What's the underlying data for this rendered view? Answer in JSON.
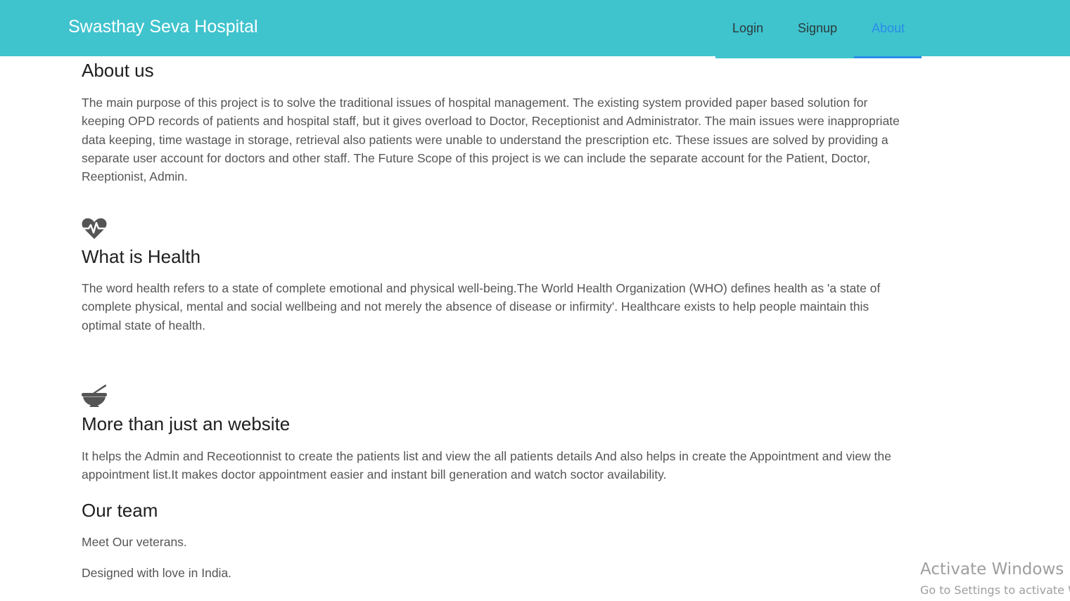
{
  "navbar": {
    "brand": "Swasthay Seva Hospital",
    "links": {
      "login": "Login",
      "signup": "Signup",
      "about": "About"
    },
    "active_link": "about",
    "background_color": "#3fc3cd",
    "active_color": "#2a8de8"
  },
  "sections": {
    "about": {
      "heading": "About us",
      "body": "The main purpose of this project is to solve the traditional issues of hospital management. The existing system provided paper based solution for keeping OPD records of patients and hospital staff, but it gives overload to Doctor, Receptionist and Administrator. The main issues were inappropriate data keeping, time wastage in storage, retrieval also patients were unable to understand the prescription etc. These issues are solved by providing a separate user account for doctors and other staff. The Future Scope of this project is we can include the separate account for the Patient, Doctor, Reeptionist, Admin."
    },
    "health": {
      "icon": "heartbeat-icon",
      "heading": "What is Health",
      "body": "The word health refers to a state of complete emotional and physical well-being.The World Health Organization (WHO) defines health as 'a state of complete physical, mental and social wellbeing and not merely the absence of disease or infirmity'. Healthcare exists to help people maintain this optimal state of health."
    },
    "website": {
      "icon": "mortar-pestle-icon",
      "heading": "More than just an website",
      "body": "It helps the Admin and Receotionnist to create the patients list and view the all patients details And also helps in create the Appointment and view the appointment list.It makes doctor appointment easier and instant bill generation and watch soctor availability."
    },
    "team": {
      "heading": "Our team",
      "line1": "Meet Our veterans.",
      "line2": "Designed with love in India."
    }
  },
  "watermark": {
    "title": "Activate Windows",
    "subtitle": "Go to Settings to activate Windows."
  }
}
